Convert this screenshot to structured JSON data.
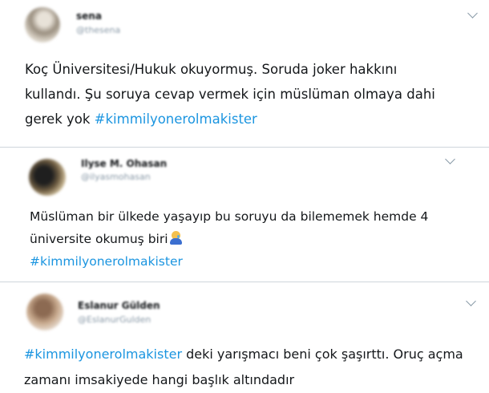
{
  "tweets": [
    {
      "author": "sena",
      "handle": "@thesena",
      "text_before": "Koç Üniversitesi/Hukuk okuyormuş. Soruda joker hakkını kullandı. Şu soruya cevap vermek için müslüman olmaya dahi gerek yok ",
      "hashtag": "#kimmilyonerolmakister",
      "text_after": ""
    },
    {
      "author": "Ilyse M. Ohasan",
      "handle": "@ilyasmohasan",
      "text_before": "Müslüman bir ülkede yaşayıp bu soruyu da bilememek hemde 4 üniversite okumuş biri",
      "emoji": "crying-person-emoji",
      "hashtag": "#kimmilyonerolmakister",
      "text_after": ""
    },
    {
      "author": "Eslanur Gülden",
      "handle": "@EslanurGulden",
      "text_before": "",
      "hashtag": "#kimmilyonerolmakister",
      "text_after": " deki yarışmacı beni çok şaşırttı. Oruç açma zamanı imsakiyede hangi başlık altındadır"
    }
  ],
  "colors": {
    "hashtag": "#1b95e0",
    "text": "#14171a",
    "secondary": "#8a9aa8",
    "divider": "#cfd6dc"
  }
}
